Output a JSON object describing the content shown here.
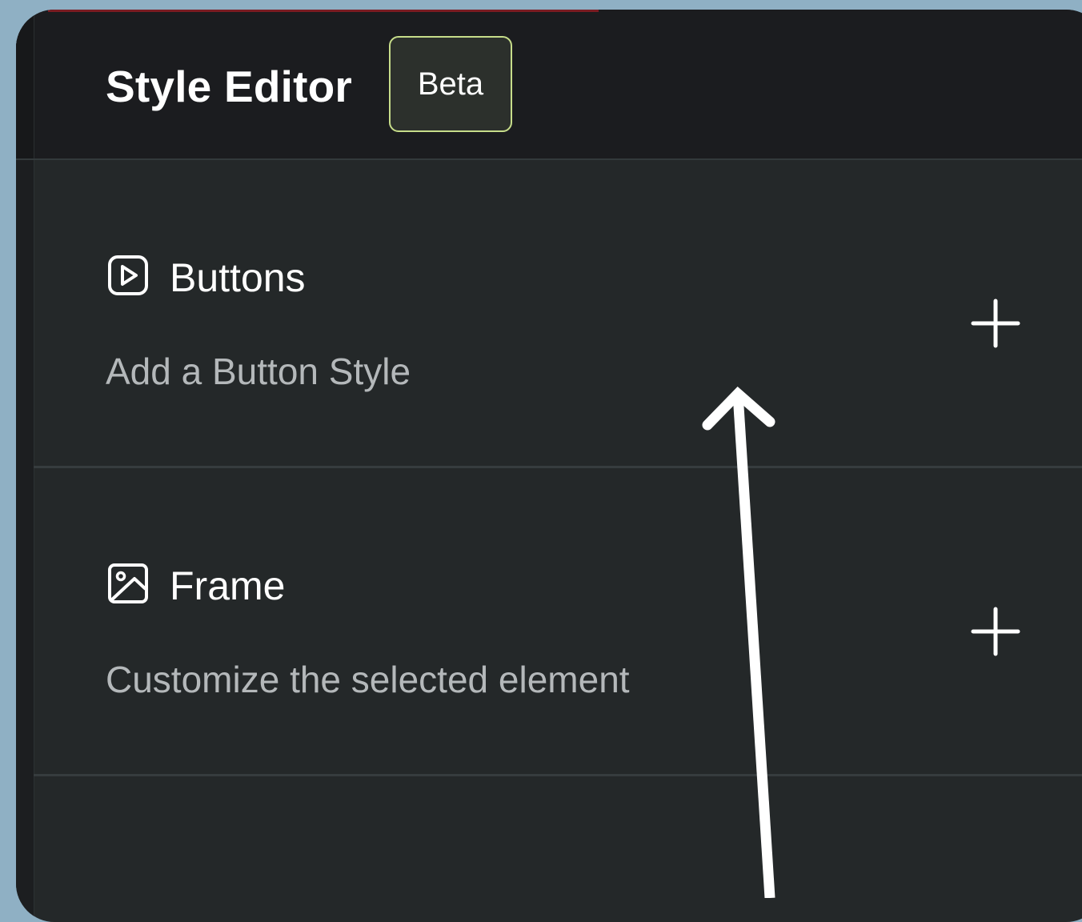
{
  "header": {
    "title": "Style Editor",
    "badge": "Beta"
  },
  "sections": [
    {
      "title": "Buttons",
      "description": "Add a Button Style",
      "icon": "play-square-icon"
    },
    {
      "title": "Frame",
      "description": "Customize the selected element",
      "icon": "image-icon"
    }
  ],
  "colors": {
    "background": "#8fb0c4",
    "panel": "#242829",
    "header": "#1b1c1f",
    "badge_border": "#c7dd8a",
    "accent": "#7a1c22"
  }
}
